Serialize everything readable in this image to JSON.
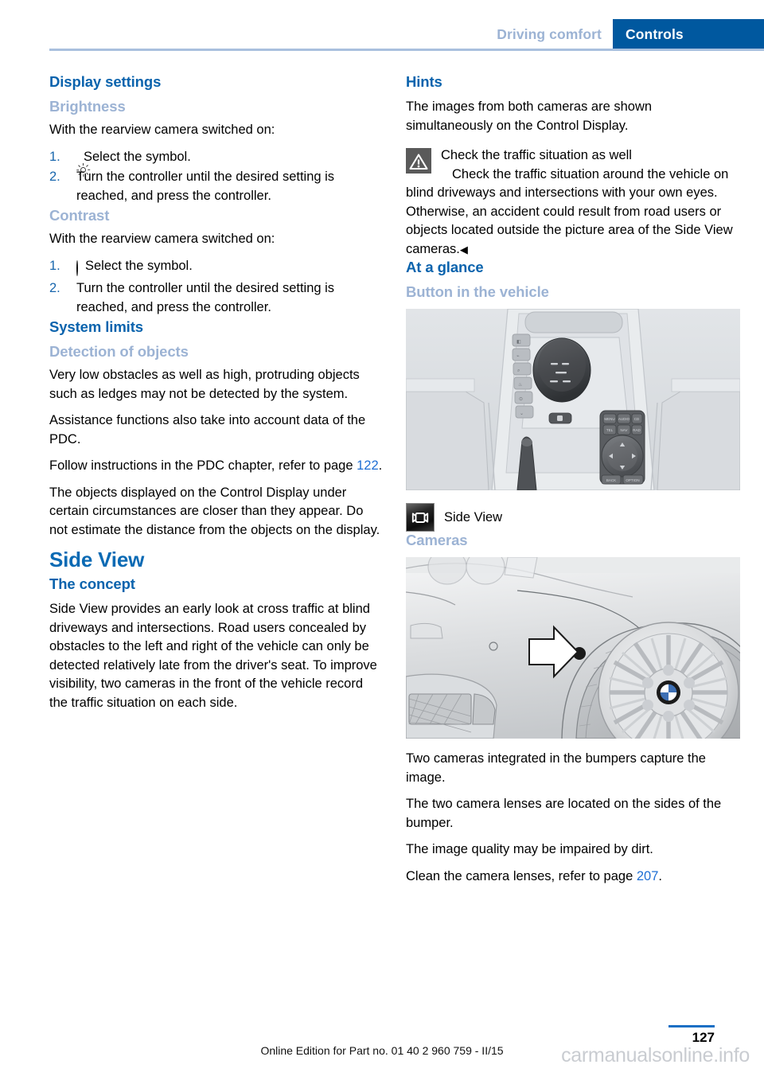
{
  "header": {
    "breadcrumb_inactive": "Driving comfort",
    "breadcrumb_active": "Controls"
  },
  "left_column": {
    "h2_display_settings": "Display settings",
    "h3_brightness": "Brightness",
    "brightness_intro": "With the rearview camera switched on:",
    "brightness_steps": [
      {
        "num": "1.",
        "icon": "brightness-sun-icon",
        "text": "Select the symbol."
      },
      {
        "num": "2.",
        "icon": "",
        "text": "Turn the controller until the desired setting is reached, and press the controller."
      }
    ],
    "h3_contrast": "Contrast",
    "contrast_intro": "With the rearview camera switched on:",
    "contrast_steps": [
      {
        "num": "1.",
        "icon": "contrast-half-circle-icon",
        "text": "Select the symbol."
      },
      {
        "num": "2.",
        "icon": "",
        "text": "Turn the controller until the desired setting is reached, and press the controller."
      }
    ],
    "h2_system_limits": "System limits",
    "h3_detection": "Detection of objects",
    "detection_p1": "Very low obstacles as well as high, protruding objects such as ledges may not be detected by the system.",
    "detection_p2": "Assistance functions also take into account data of the PDC.",
    "detection_p3_pre": "Follow instructions in the PDC chapter, refer to page ",
    "detection_p3_ref": "122",
    "detection_p3_post": ".",
    "detection_p4": "The objects displayed on the Control Display under certain circumstances are closer than they appear. Do not estimate the distance from the objects on the display.",
    "h1_side_view": "Side View",
    "h2_the_concept": "The concept",
    "concept_p1": "Side View provides an early look at cross traffic at blind driveways and intersections. Road users concealed by obstacles to the left and right of the vehicle can only be detected relatively late from the driver's seat. To improve visibility, two cameras in the front of the vehicle record the traffic situation on each side."
  },
  "right_column": {
    "h2_hints": "Hints",
    "hints_p1": "The images from both cameras are shown simultaneously on the Control Display.",
    "warning_title": "Check the traffic situation as well",
    "warning_body": "Check the traffic situation around the vehicle on blind driveways and intersections with your own eyes. Otherwise, an accident could result from road users or objects located outside the picture area of the Side View cameras.",
    "warning_endmark": "◀",
    "h2_at_a_glance": "At a glance",
    "h3_button_in_vehicle": "Button in the vehicle",
    "figure_console_alt": "Center console with gear selector, function buttons and iDrive controller",
    "side_view_caption": "Side View",
    "h3_cameras": "Cameras",
    "figure_bumper_alt": "Front bumper and wheel with arrow pointing at the camera lens location",
    "cameras_p1": "Two cameras integrated in the bumpers capture the image.",
    "cameras_p2": "The two camera lenses are located on the sides of the bumper.",
    "cameras_p3": "The image quality may be impaired by dirt.",
    "cameras_p4_pre": "Clean the camera lenses, refer to page ",
    "cameras_p4_ref": "207",
    "cameras_p4_post": "."
  },
  "footer": {
    "edition_note": "Online Edition for Part no. 01 40 2 960 759 - II/15",
    "page_number": "127",
    "watermark": "carmanualsonline.info"
  },
  "colors": {
    "accent_blue": "#00589f",
    "heading_blue": "#0a63ad",
    "subheading_blue": "#9cb3d4",
    "link_blue": "#1f6fd4",
    "rule_blue": "#a9c0de"
  }
}
